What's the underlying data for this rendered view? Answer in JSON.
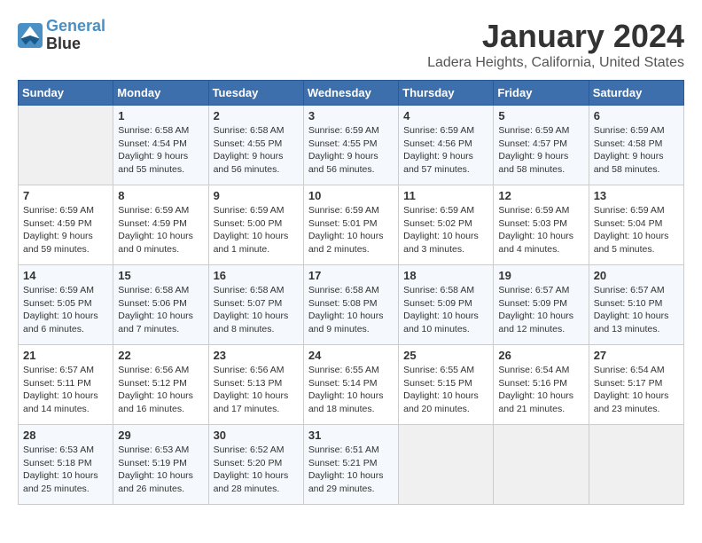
{
  "logo": {
    "line1": "General",
    "line2": "Blue"
  },
  "title": "January 2024",
  "location": "Ladera Heights, California, United States",
  "days_of_week": [
    "Sunday",
    "Monday",
    "Tuesday",
    "Wednesday",
    "Thursday",
    "Friday",
    "Saturday"
  ],
  "weeks": [
    [
      {
        "day": "",
        "info": ""
      },
      {
        "day": "1",
        "info": "Sunrise: 6:58 AM\nSunset: 4:54 PM\nDaylight: 9 hours\nand 55 minutes."
      },
      {
        "day": "2",
        "info": "Sunrise: 6:58 AM\nSunset: 4:55 PM\nDaylight: 9 hours\nand 56 minutes."
      },
      {
        "day": "3",
        "info": "Sunrise: 6:59 AM\nSunset: 4:55 PM\nDaylight: 9 hours\nand 56 minutes."
      },
      {
        "day": "4",
        "info": "Sunrise: 6:59 AM\nSunset: 4:56 PM\nDaylight: 9 hours\nand 57 minutes."
      },
      {
        "day": "5",
        "info": "Sunrise: 6:59 AM\nSunset: 4:57 PM\nDaylight: 9 hours\nand 58 minutes."
      },
      {
        "day": "6",
        "info": "Sunrise: 6:59 AM\nSunset: 4:58 PM\nDaylight: 9 hours\nand 58 minutes."
      }
    ],
    [
      {
        "day": "7",
        "info": "Sunrise: 6:59 AM\nSunset: 4:59 PM\nDaylight: 9 hours\nand 59 minutes."
      },
      {
        "day": "8",
        "info": "Sunrise: 6:59 AM\nSunset: 4:59 PM\nDaylight: 10 hours\nand 0 minutes."
      },
      {
        "day": "9",
        "info": "Sunrise: 6:59 AM\nSunset: 5:00 PM\nDaylight: 10 hours\nand 1 minute."
      },
      {
        "day": "10",
        "info": "Sunrise: 6:59 AM\nSunset: 5:01 PM\nDaylight: 10 hours\nand 2 minutes."
      },
      {
        "day": "11",
        "info": "Sunrise: 6:59 AM\nSunset: 5:02 PM\nDaylight: 10 hours\nand 3 minutes."
      },
      {
        "day": "12",
        "info": "Sunrise: 6:59 AM\nSunset: 5:03 PM\nDaylight: 10 hours\nand 4 minutes."
      },
      {
        "day": "13",
        "info": "Sunrise: 6:59 AM\nSunset: 5:04 PM\nDaylight: 10 hours\nand 5 minutes."
      }
    ],
    [
      {
        "day": "14",
        "info": "Sunrise: 6:59 AM\nSunset: 5:05 PM\nDaylight: 10 hours\nand 6 minutes."
      },
      {
        "day": "15",
        "info": "Sunrise: 6:58 AM\nSunset: 5:06 PM\nDaylight: 10 hours\nand 7 minutes."
      },
      {
        "day": "16",
        "info": "Sunrise: 6:58 AM\nSunset: 5:07 PM\nDaylight: 10 hours\nand 8 minutes."
      },
      {
        "day": "17",
        "info": "Sunrise: 6:58 AM\nSunset: 5:08 PM\nDaylight: 10 hours\nand 9 minutes."
      },
      {
        "day": "18",
        "info": "Sunrise: 6:58 AM\nSunset: 5:09 PM\nDaylight: 10 hours\nand 10 minutes."
      },
      {
        "day": "19",
        "info": "Sunrise: 6:57 AM\nSunset: 5:09 PM\nDaylight: 10 hours\nand 12 minutes."
      },
      {
        "day": "20",
        "info": "Sunrise: 6:57 AM\nSunset: 5:10 PM\nDaylight: 10 hours\nand 13 minutes."
      }
    ],
    [
      {
        "day": "21",
        "info": "Sunrise: 6:57 AM\nSunset: 5:11 PM\nDaylight: 10 hours\nand 14 minutes."
      },
      {
        "day": "22",
        "info": "Sunrise: 6:56 AM\nSunset: 5:12 PM\nDaylight: 10 hours\nand 16 minutes."
      },
      {
        "day": "23",
        "info": "Sunrise: 6:56 AM\nSunset: 5:13 PM\nDaylight: 10 hours\nand 17 minutes."
      },
      {
        "day": "24",
        "info": "Sunrise: 6:55 AM\nSunset: 5:14 PM\nDaylight: 10 hours\nand 18 minutes."
      },
      {
        "day": "25",
        "info": "Sunrise: 6:55 AM\nSunset: 5:15 PM\nDaylight: 10 hours\nand 20 minutes."
      },
      {
        "day": "26",
        "info": "Sunrise: 6:54 AM\nSunset: 5:16 PM\nDaylight: 10 hours\nand 21 minutes."
      },
      {
        "day": "27",
        "info": "Sunrise: 6:54 AM\nSunset: 5:17 PM\nDaylight: 10 hours\nand 23 minutes."
      }
    ],
    [
      {
        "day": "28",
        "info": "Sunrise: 6:53 AM\nSunset: 5:18 PM\nDaylight: 10 hours\nand 25 minutes."
      },
      {
        "day": "29",
        "info": "Sunrise: 6:53 AM\nSunset: 5:19 PM\nDaylight: 10 hours\nand 26 minutes."
      },
      {
        "day": "30",
        "info": "Sunrise: 6:52 AM\nSunset: 5:20 PM\nDaylight: 10 hours\nand 28 minutes."
      },
      {
        "day": "31",
        "info": "Sunrise: 6:51 AM\nSunset: 5:21 PM\nDaylight: 10 hours\nand 29 minutes."
      },
      {
        "day": "",
        "info": ""
      },
      {
        "day": "",
        "info": ""
      },
      {
        "day": "",
        "info": ""
      }
    ]
  ]
}
